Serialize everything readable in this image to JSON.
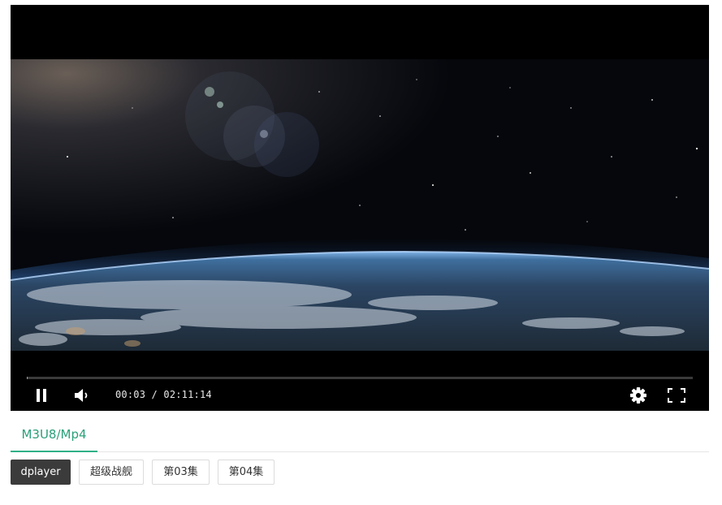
{
  "player": {
    "current_time": "00:03",
    "separator": " / ",
    "duration": "02:11:14",
    "progress_fraction": 0.0004,
    "play_state": "playing",
    "icons": {
      "play_toggle": "pause-icon",
      "volume": "volume-icon",
      "settings": "gear-icon",
      "fullscreen": "fullscreen-icon"
    }
  },
  "tabs": [
    {
      "label": "M3U8/Mp4",
      "active": true
    }
  ],
  "episodes": [
    {
      "label": "dplayer",
      "active": true
    },
    {
      "label": "超级战舰",
      "active": false
    },
    {
      "label": "第03集",
      "active": false
    },
    {
      "label": "第04集",
      "active": false
    }
  ],
  "colors": {
    "accent": "#2eb086",
    "active_button": "#3b3b3b",
    "player_bg": "#000000"
  }
}
